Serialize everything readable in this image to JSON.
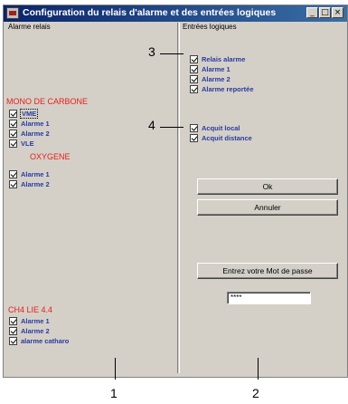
{
  "window": {
    "title": "Configuration du relais d'alarme et des entrées logiques",
    "buttons": {
      "minimize": "_",
      "maximize": "□",
      "close": "×"
    }
  },
  "left_panel": {
    "group_label": "Alarme relais",
    "sections": [
      {
        "title": "MONO DE CARBONE",
        "items": [
          "VME",
          "Alarme 1",
          "Alarme 2",
          "VLE"
        ]
      },
      {
        "title": "OXYGENE",
        "items": [
          "Alarme 1",
          "Alarme 2"
        ]
      },
      {
        "title": "CH4 LIE 4.4",
        "items": [
          "Alarme 1",
          "Alarme 2",
          "alarme catharo"
        ]
      }
    ]
  },
  "right_panel": {
    "group_label": "Entrées logiques",
    "group1": [
      "Relais alarme",
      "Alarme 1",
      "Alarme 2",
      "Alarme reportée"
    ],
    "group2": [
      "Acquit local",
      "Acquit distance"
    ],
    "ok_label": "Ok",
    "cancel_label": "Annuler",
    "password_button": "Entrez votre Mot de passe",
    "password_value": "****"
  },
  "callouts": {
    "c1": "1",
    "c2": "2",
    "c3": "3",
    "c4": "4"
  },
  "colors": {
    "section_title": "#e8201a",
    "checkbox_label": "#2a3aa0",
    "window_bg": "#d4d0c8",
    "titlebar": "#0a246a"
  }
}
